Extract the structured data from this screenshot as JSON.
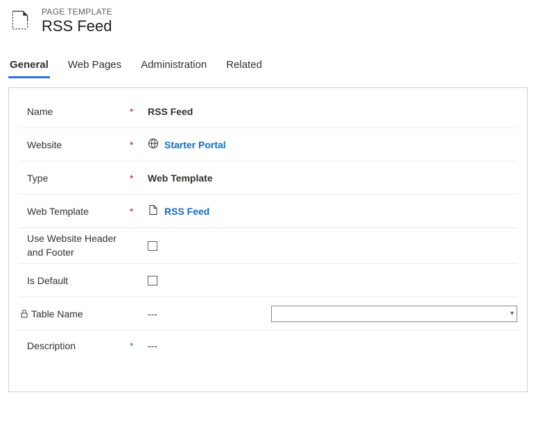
{
  "header": {
    "eyebrow": "PAGE TEMPLATE",
    "title": "RSS Feed"
  },
  "tabs": [
    {
      "label": "General",
      "active": true
    },
    {
      "label": "Web Pages",
      "active": false
    },
    {
      "label": "Administration",
      "active": false
    },
    {
      "label": "Related",
      "active": false
    }
  ],
  "fields": {
    "name": {
      "label": "Name",
      "value": "RSS Feed"
    },
    "website": {
      "label": "Website",
      "value": "Starter Portal"
    },
    "type": {
      "label": "Type",
      "value": "Web Template"
    },
    "webtemplate": {
      "label": "Web Template",
      "value": "RSS Feed"
    },
    "useheader": {
      "label": "Use Website Header and Footer"
    },
    "isdefault": {
      "label": "Is Default"
    },
    "tablename": {
      "label": "Table Name",
      "value": "---"
    },
    "description": {
      "label": "Description",
      "value": "---"
    }
  }
}
